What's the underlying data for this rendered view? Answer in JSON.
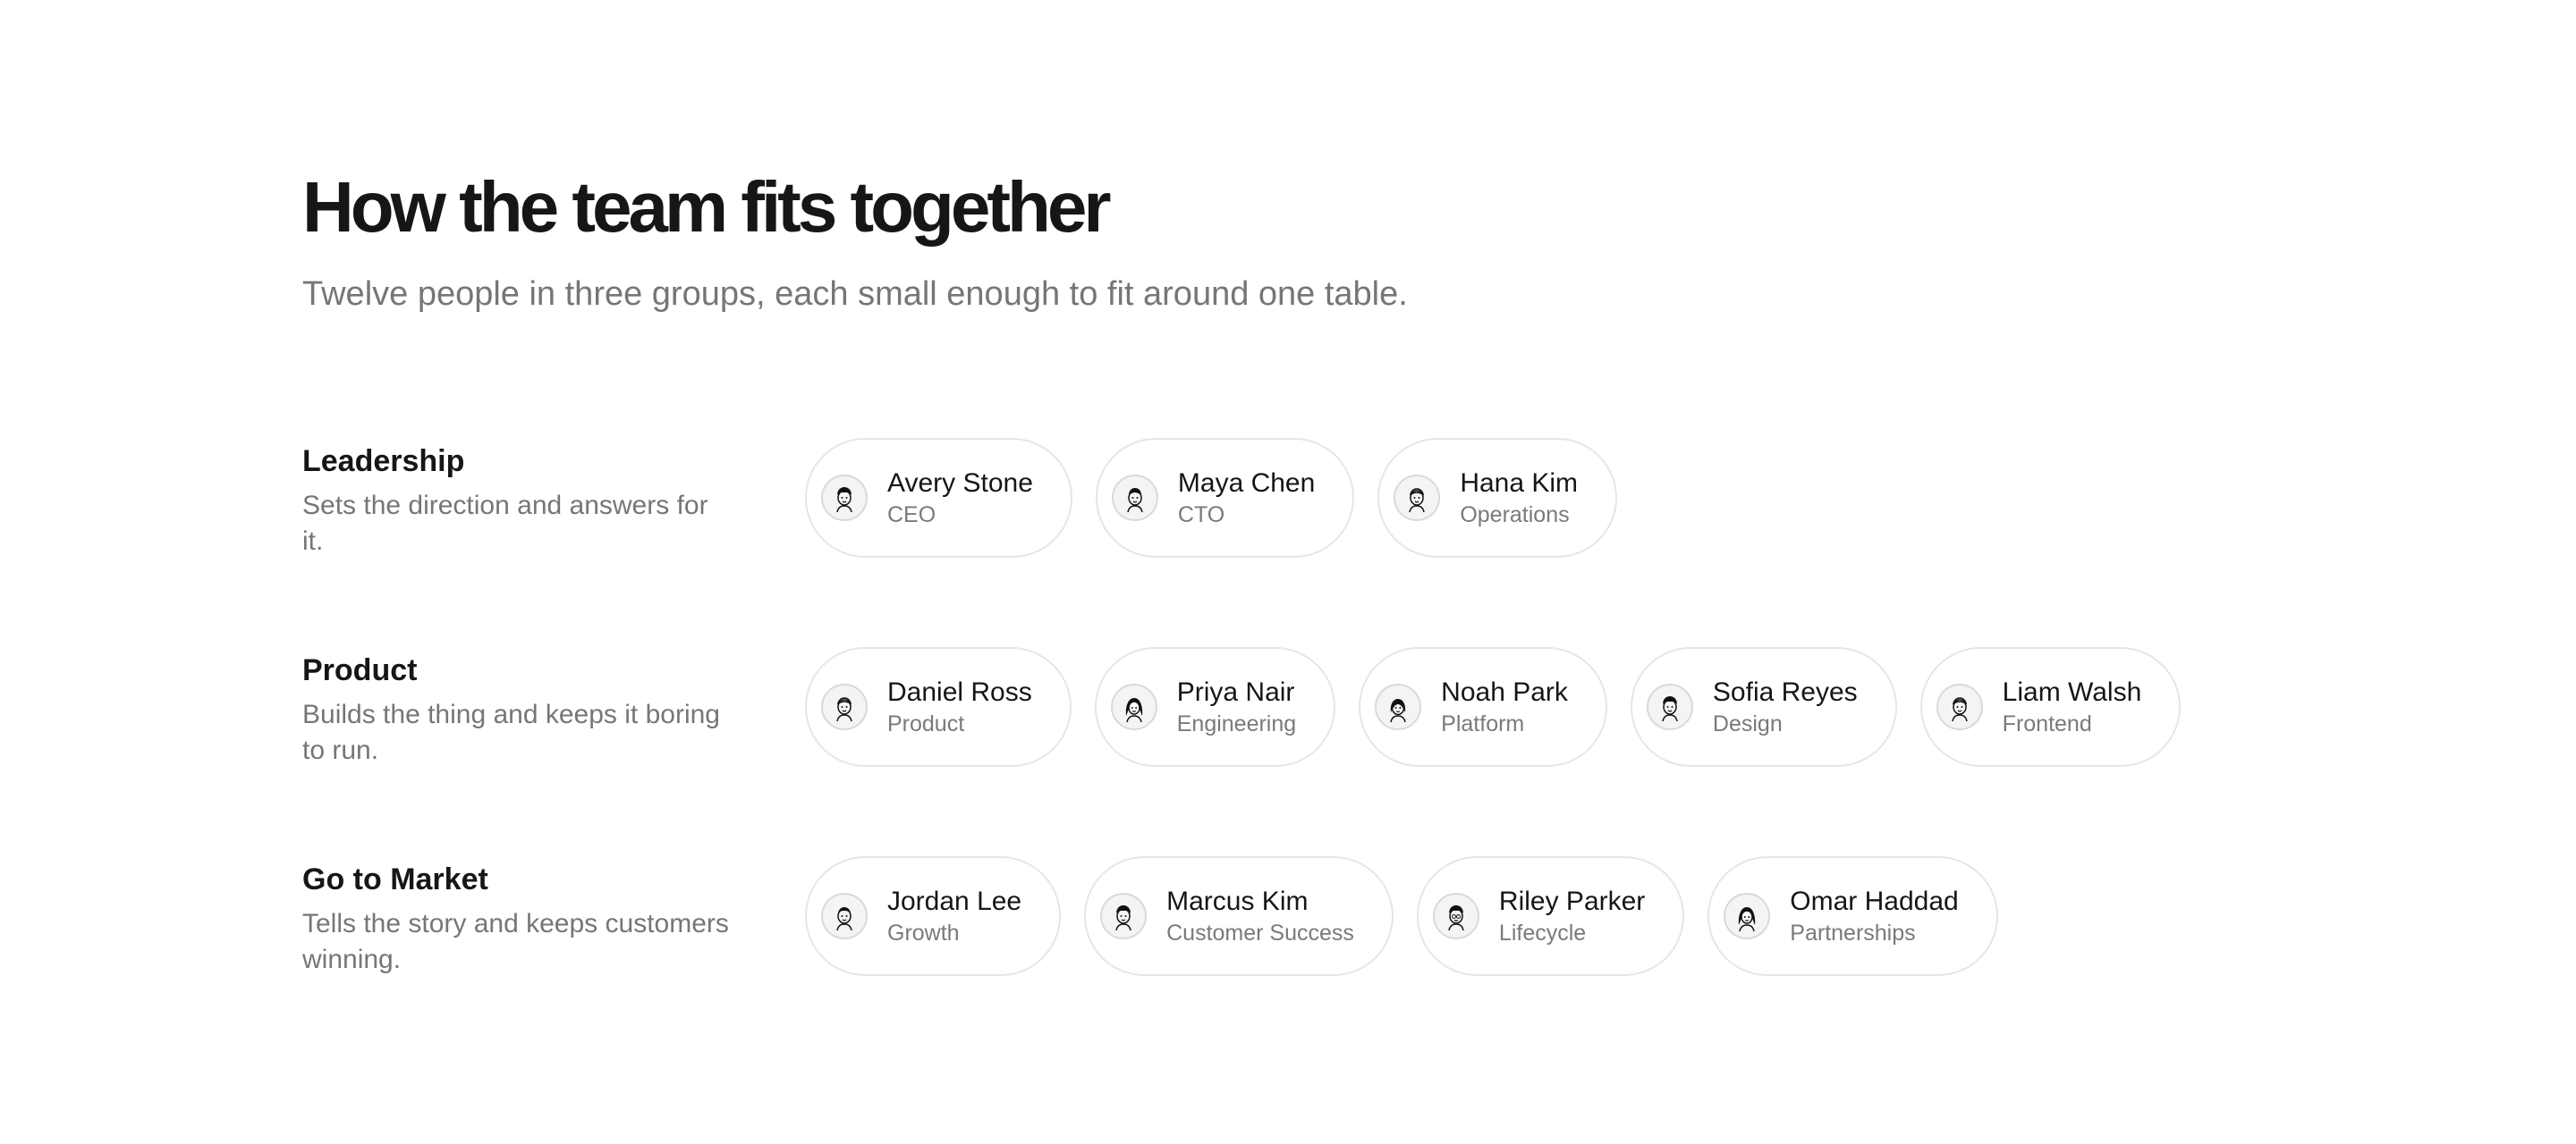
{
  "header": {
    "title": "How the team fits together",
    "subtitle": "Twelve people in three groups, each small enough to fit around one table."
  },
  "groups": [
    {
      "name": "Leadership",
      "description": "Sets the direction and answers for it.",
      "members": [
        {
          "name": "Avery Stone",
          "role": "CEO",
          "avatar": "avatar-icon"
        },
        {
          "name": "Maya Chen",
          "role": "CTO",
          "avatar": "avatar-icon"
        },
        {
          "name": "Hana Kim",
          "role": "Operations",
          "avatar": "avatar-icon"
        }
      ]
    },
    {
      "name": "Product",
      "description": "Builds the thing and keeps it boring to run.",
      "members": [
        {
          "name": "Daniel Ross",
          "role": "Product",
          "avatar": "avatar-icon"
        },
        {
          "name": "Priya Nair",
          "role": "Engineering",
          "avatar": "avatar-icon"
        },
        {
          "name": "Noah Park",
          "role": "Platform",
          "avatar": "avatar-icon"
        },
        {
          "name": "Sofia Reyes",
          "role": "Design",
          "avatar": "avatar-icon"
        },
        {
          "name": "Liam Walsh",
          "role": "Frontend",
          "avatar": "avatar-icon"
        }
      ]
    },
    {
      "name": "Go to Market",
      "description": "Tells the story and keeps customers winning.",
      "members": [
        {
          "name": "Jordan Lee",
          "role": "Growth",
          "avatar": "avatar-icon"
        },
        {
          "name": "Marcus Kim",
          "role": "Customer Success",
          "avatar": "avatar-icon"
        },
        {
          "name": "Riley Parker",
          "role": "Lifecycle",
          "avatar": "avatar-icon"
        },
        {
          "name": "Omar Haddad",
          "role": "Partnerships",
          "avatar": "avatar-icon"
        }
      ]
    }
  ]
}
